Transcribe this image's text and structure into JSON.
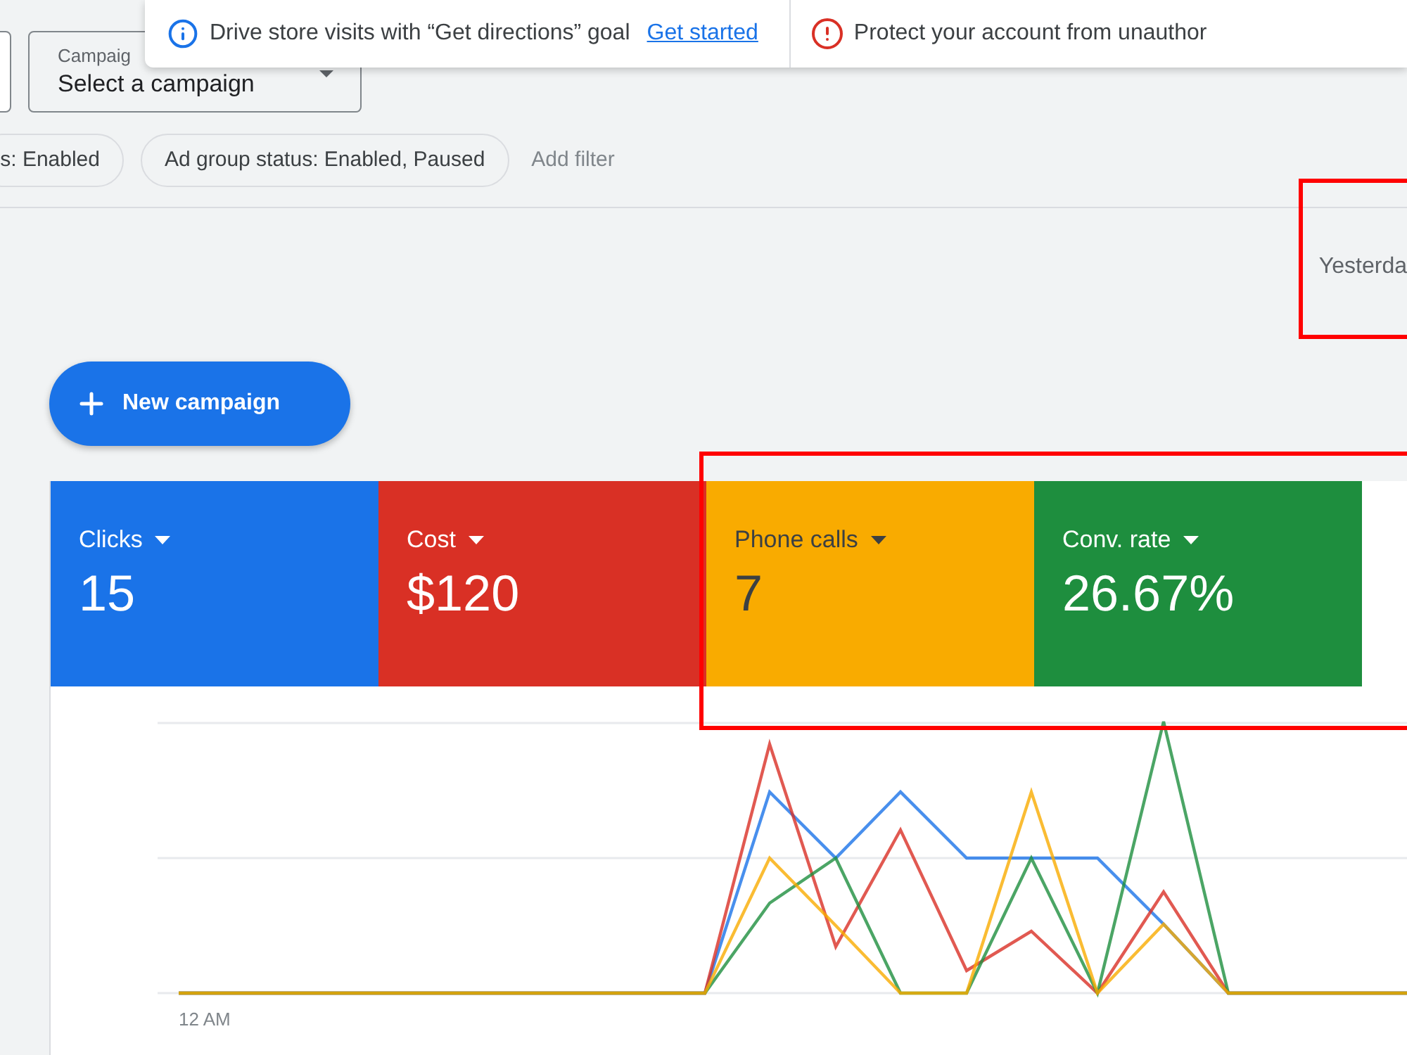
{
  "notifications": [
    {
      "kind": "info",
      "text": "Drive store visits with “Get directions” goal",
      "link": "Get started"
    },
    {
      "kind": "warning",
      "text": "Protect your account from unauthor"
    }
  ],
  "campaign_select": {
    "label": "Campaig",
    "value": "Select a campaign"
  },
  "filters": [
    {
      "label": "s: Enabled"
    },
    {
      "label": "Ad group status: Enabled, Paused"
    }
  ],
  "add_filter": "Add filter",
  "date_range": "Yesterda",
  "new_campaign_button": "New campaign",
  "metrics": [
    {
      "label": "Clicks",
      "value": "15",
      "color": "#1a73e8",
      "selected": true
    },
    {
      "label": "Cost",
      "value": "$120",
      "color": "#d93025",
      "selected": true
    },
    {
      "label": "Phone calls",
      "value": "7",
      "color": "#f9ab00",
      "selected": true
    },
    {
      "label": "Conv. rate",
      "value": "26.67%",
      "color": "#1e8e3e",
      "selected": true
    }
  ],
  "chart": {
    "x_axis_labels": [
      "12 AM"
    ]
  }
}
